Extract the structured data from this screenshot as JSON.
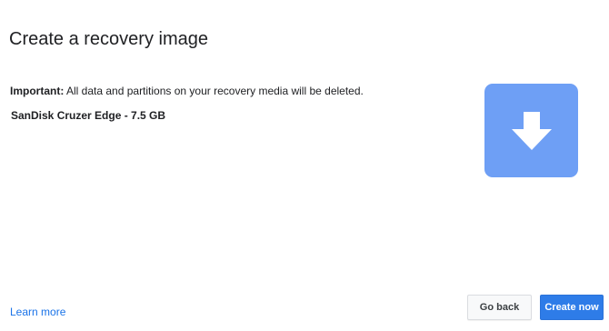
{
  "header": {
    "title": "Create a recovery image"
  },
  "main": {
    "warning_label": "Important:",
    "warning_text": "All data and partitions on your recovery media will be deleted.",
    "device_name": "SanDisk Cruzer Edge - 7.5 GB",
    "illustration_icon": "download-arrow-icon",
    "illustration_color": "#6e9ff5"
  },
  "footer": {
    "learn_more": "Learn more",
    "back_label": "Go back",
    "create_label": "Create now",
    "primary_color": "#2e7ce8",
    "link_color": "#1a73e8"
  }
}
